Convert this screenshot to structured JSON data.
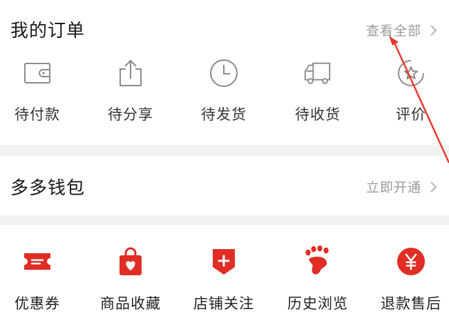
{
  "orders": {
    "title": "我的订单",
    "view_all": "查看全部",
    "items": [
      {
        "label": "待付款",
        "icon": "wallet-icon"
      },
      {
        "label": "待分享",
        "icon": "share-icon"
      },
      {
        "label": "待发货",
        "icon": "clock-icon"
      },
      {
        "label": "待收货",
        "icon": "truck-icon"
      },
      {
        "label": "评价",
        "icon": "review-icon"
      }
    ]
  },
  "wallet": {
    "title": "多多钱包",
    "action": "立即开通"
  },
  "services": {
    "items": [
      {
        "label": "优惠券",
        "icon": "coupon-icon"
      },
      {
        "label": "商品收藏",
        "icon": "favorite-bag-icon"
      },
      {
        "label": "店铺关注",
        "icon": "store-follow-icon"
      },
      {
        "label": "历史浏览",
        "icon": "footprint-icon"
      },
      {
        "label": "退款售后",
        "icon": "refund-icon"
      }
    ]
  },
  "colors": {
    "brand_red": "#e02e24",
    "outline_gray": "#8a8a8a",
    "annotation_red": "#e8392c"
  }
}
